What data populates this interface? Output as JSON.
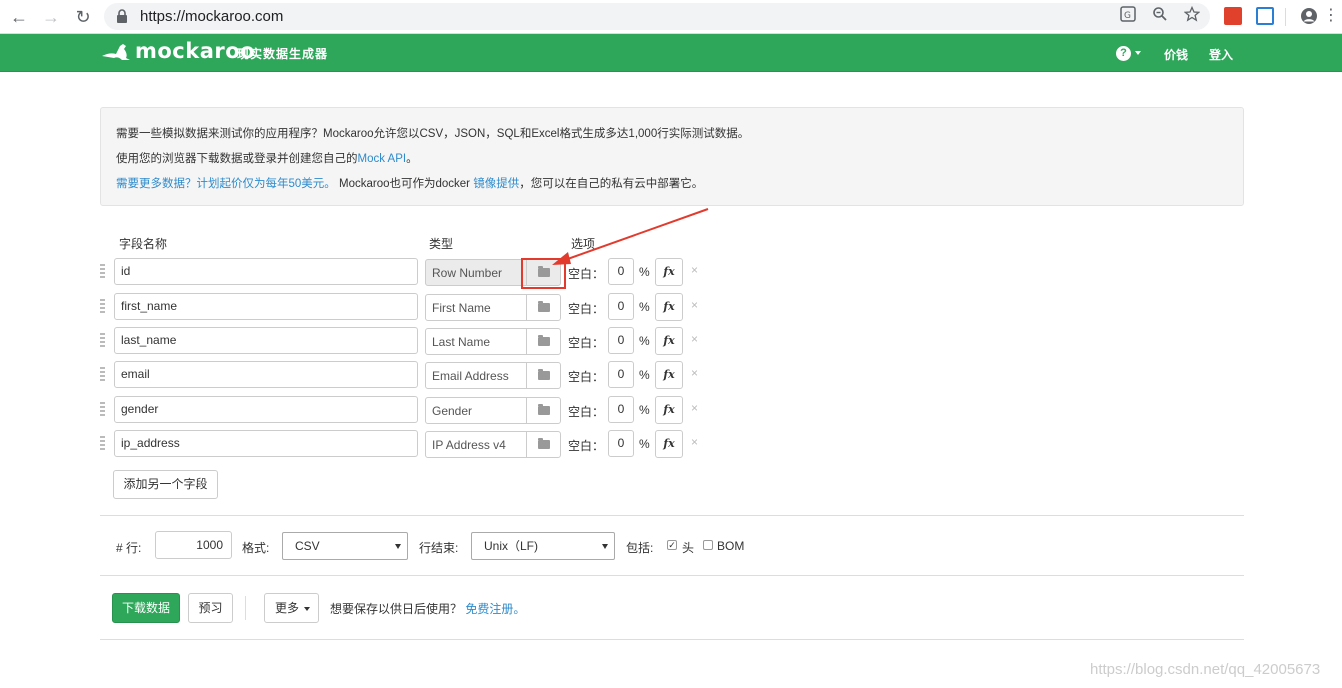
{
  "browser": {
    "url": "https://mockaroo.com"
  },
  "nav": {
    "logo_text": "mockaroo",
    "tagline": "现实数据生成器",
    "help_label": "?",
    "pricing": "价钱",
    "login": "登入"
  },
  "info": {
    "line1": "需要一些模拟数据来测试你的应用程序？Mockaroo允许您以CSV，JSON，SQL和Excel格式生成多达1,000行实际测试数据。",
    "line2_prefix": "使用您的浏览器下载数据或登录并创建您自己的",
    "line2_link": "Mock API",
    "line2_suffix": "。",
    "line3_link": "需要更多数据？计划起价仅为每年50美元。",
    "line3_middle": " Mockaroo也可作为docker ",
    "line3_link2": "镜像提供",
    "line3_suffix": "，您可以在自己的私有云中部署它。"
  },
  "table": {
    "headers": {
      "name": "字段名称",
      "type": "类型",
      "options": "选项"
    },
    "blank_label": "空白：",
    "pct_sign": "%",
    "fx_label": "fx",
    "delete_label": "×",
    "rows": [
      {
        "name": "id",
        "type": "Row Number",
        "blank": "0"
      },
      {
        "name": "first_name",
        "type": "First Name",
        "blank": "0"
      },
      {
        "name": "last_name",
        "type": "Last Name",
        "blank": "0"
      },
      {
        "name": "email",
        "type": "Email Address",
        "blank": "0"
      },
      {
        "name": "gender",
        "type": "Gender",
        "blank": "0"
      },
      {
        "name": "ip_address",
        "type": "IP Address v4",
        "blank": "0"
      }
    ],
    "add_field": "添加另一个字段"
  },
  "options": {
    "rows_label": "# 行:",
    "rows_value": "1000",
    "format_label": "格式:",
    "format_value": "CSV",
    "line_ending_label": "行结束:",
    "line_ending_value": "Unix（LF)",
    "include_label": "包括:",
    "header_label": "头",
    "header_checked": true,
    "bom_label": "BOM",
    "bom_checked": false
  },
  "actions": {
    "download": "下载数据",
    "preview": "预习",
    "more": "更多",
    "save_prompt": "想要保存以供日后使用？",
    "signup": "免费注册。"
  },
  "watermark": "https://blog.csdn.net/qq_42005673",
  "colors": {
    "brand_green": "#2ea75a",
    "link_blue": "#2e8bcc",
    "annotation_red": "#e23b2e"
  }
}
